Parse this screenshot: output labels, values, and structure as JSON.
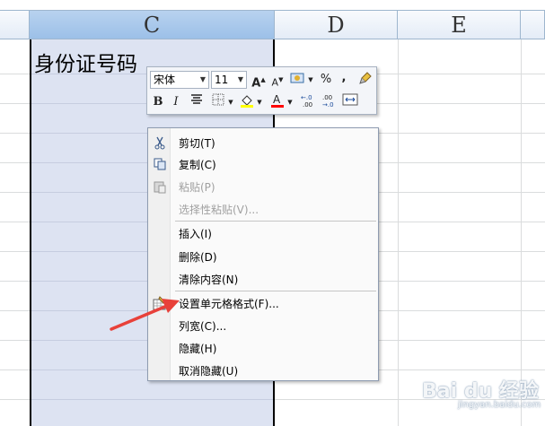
{
  "columns": [
    "C",
    "D",
    "E"
  ],
  "cell_value": "身份证号码",
  "mini_toolbar": {
    "font_name": "宋体",
    "font_size": "11",
    "percent": "%",
    "comma": ",",
    "bold": "B",
    "italic": "I"
  },
  "context_menu": {
    "items": [
      {
        "label": "剪切(T)",
        "icon": "scissors-icon",
        "enabled": true
      },
      {
        "label": "复制(C)",
        "icon": "copy-icon",
        "enabled": true
      },
      {
        "label": "粘贴(P)",
        "icon": "paste-icon",
        "enabled": false
      },
      {
        "label": "选择性粘贴(V)...",
        "icon": "",
        "enabled": false
      },
      {
        "label": "插入(I)",
        "icon": "",
        "enabled": true
      },
      {
        "label": "删除(D)",
        "icon": "",
        "enabled": true
      },
      {
        "label": "清除内容(N)",
        "icon": "",
        "enabled": true
      },
      {
        "label": "设置单元格格式(F)...",
        "icon": "format-cells-icon",
        "enabled": true
      },
      {
        "label": "列宽(C)...",
        "icon": "",
        "enabled": true
      },
      {
        "label": "隐藏(H)",
        "icon": "",
        "enabled": true
      },
      {
        "label": "取消隐藏(U)",
        "icon": "",
        "enabled": true
      }
    ]
  },
  "colors": {
    "selection_fill": "#dde3f2",
    "header_selected": "#9cc0e8",
    "arrow": "#e8413a"
  },
  "watermark": {
    "text": "Bai du 经验",
    "sub": "jingyan.baidu.com"
  }
}
